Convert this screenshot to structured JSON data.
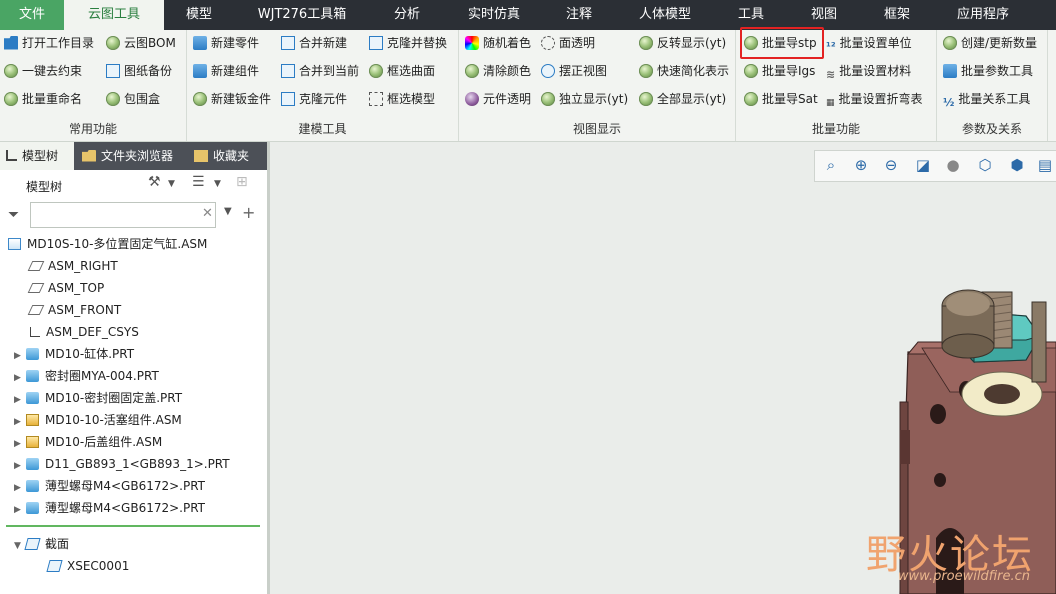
{
  "menu": {
    "file": "文件",
    "tabs": [
      "云图工具",
      "模型",
      "WJT276工具箱",
      "分析",
      "实时仿真",
      "注释",
      "人体模型",
      "工具",
      "视图",
      "框架",
      "应用程序"
    ]
  },
  "ribbon": {
    "groups": {
      "common": {
        "label": "常用功能",
        "buttons": [
          "打开工作目录",
          "一键去约束",
          "批量重命名",
          "云图BOM",
          "图纸备份",
          "包围盒"
        ]
      },
      "modeling": {
        "label": "建模工具",
        "buttons": [
          "新建零件",
          "新建组件",
          "新建钣金件",
          "合并新建",
          "合并到当前",
          "克隆元件",
          "克隆并替换",
          "框选曲面",
          "框选模型"
        ]
      },
      "view": {
        "label": "视图显示",
        "buttons": [
          "随机着色",
          "清除颜色",
          "元件透明",
          "面透明",
          "摆正视图",
          "独立显示(yt)",
          "反转显示(yt)",
          "快速简化表示",
          "全部显示(yt)"
        ]
      },
      "batch": {
        "label": "批量功能",
        "buttons": [
          "批量导stp",
          "批量导Igs",
          "批量导Sat",
          "批量设置单位",
          "批量设置材料",
          "批量设置折弯表"
        ]
      },
      "params": {
        "label": "参数及关系",
        "buttons": [
          "创建/更新数量",
          "批量参数工具",
          "批量关系工具"
        ]
      }
    }
  },
  "panel": {
    "tabs": [
      "模型树",
      "文件夹浏览器",
      "收藏夹"
    ],
    "tree_title": "模型树",
    "search_placeholder": "",
    "nodes": [
      "MD10S-10-多位置固定气缸.ASM",
      "ASM_RIGHT",
      "ASM_TOP",
      "ASM_FRONT",
      "ASM_DEF_CSYS",
      "MD10-缸体.PRT",
      "密封圈MYA-004.PRT",
      "MD10-密封圈固定盖.PRT",
      "MD10-10-活塞组件.ASM",
      "MD10-后盖组件.ASM",
      "D11_GB893_1<GB893_1>.PRT",
      "薄型螺母M4<GB6172>.PRT",
      "薄型螺母M4<GB6172>.PRT"
    ],
    "section_title": "截面",
    "section_item": "XSEC0001"
  },
  "watermark": {
    "cn": "野火论坛",
    "url": "www.proewildfire.cn"
  },
  "colors": {
    "accent_green": "#4aa564",
    "menubar_dark": "#2b2f35",
    "highlight_red": "#e32222"
  }
}
